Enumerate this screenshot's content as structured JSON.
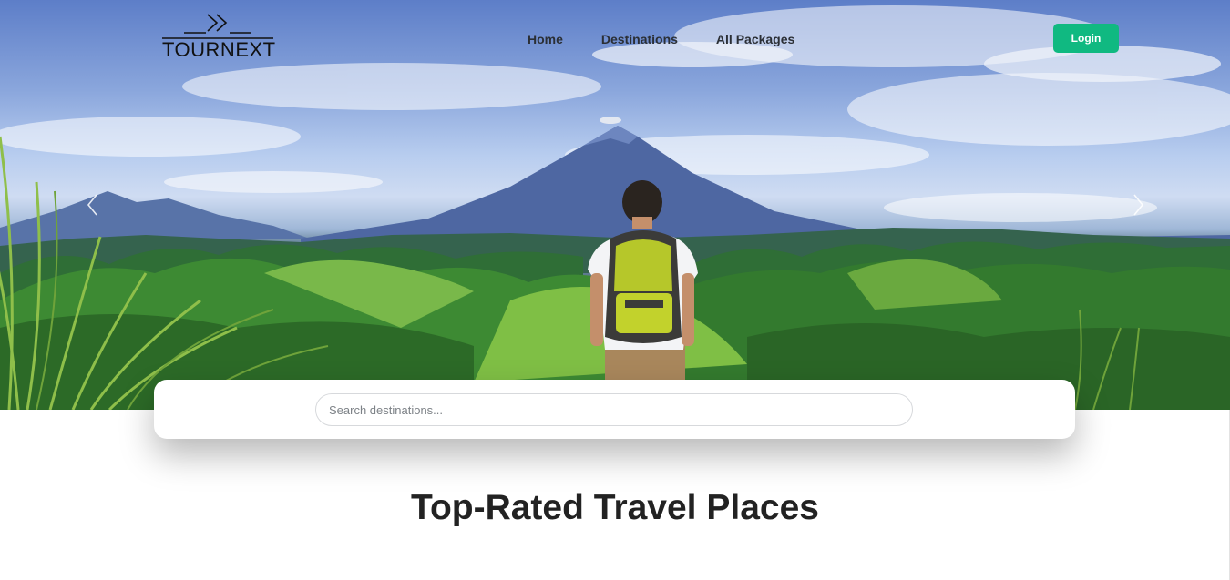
{
  "brand": {
    "name": "TOURNEXT",
    "logo_icon": "double-chevron-right-icon"
  },
  "nav": {
    "items": [
      {
        "label": "Home"
      },
      {
        "label": "Destinations"
      },
      {
        "label": "All Packages"
      }
    ]
  },
  "header": {
    "login_label": "Login"
  },
  "hero": {
    "prev_icon": "chevron-left-icon",
    "next_icon": "chevron-right-icon",
    "image": "hiker with yellow backpack facing volcano over green hills"
  },
  "search": {
    "placeholder": "Search destinations...",
    "value": ""
  },
  "section": {
    "title": "Top-Rated Travel Places"
  },
  "colors": {
    "accent": "#10b981",
    "text": "#222222",
    "nav_text": "#2b2f35"
  }
}
